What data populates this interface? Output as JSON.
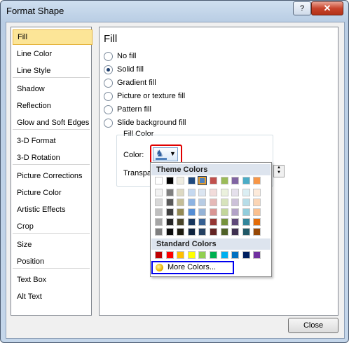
{
  "window": {
    "title": "Format Shape",
    "help_label": "?",
    "close_label": "✕"
  },
  "nav": {
    "items": [
      "Fill",
      "Line Color",
      "Line Style",
      "Shadow",
      "Reflection",
      "Glow and Soft Edges",
      "3-D Format",
      "3-D Rotation",
      "Picture Corrections",
      "Picture Color",
      "Artistic Effects",
      "Crop",
      "Size",
      "Position",
      "Text Box",
      "Alt Text"
    ],
    "selected": "Fill"
  },
  "pane": {
    "title": "Fill",
    "options": [
      "No fill",
      "Solid fill",
      "Gradient fill",
      "Picture or texture fill",
      "Pattern fill",
      "Slide background fill"
    ],
    "selected_option": "Solid fill",
    "group_title": "Fill Color",
    "color_label": "Color:",
    "transparency_label": "Transpa",
    "bucket_icon": "paint-bucket-icon",
    "accent_color": "#4f81bd"
  },
  "palette": {
    "theme_header": "Theme Colors",
    "standard_header": "Standard Colors",
    "more_colors_label": "More Colors...",
    "theme_colors": [
      [
        "#ffffff",
        "#000000",
        "#eeece1",
        "#1f497d",
        "#4f81bd",
        "#c0504d",
        "#9bbb59",
        "#8064a2",
        "#4bacc6",
        "#f79646"
      ],
      [
        "#f2f2f2",
        "#7f7f7f",
        "#ddd9c3",
        "#c6d9f0",
        "#dbe5f1",
        "#f2dcdb",
        "#ebf1dd",
        "#e5e0ec",
        "#dbeef3",
        "#fdeada"
      ],
      [
        "#d8d8d8",
        "#595959",
        "#c4bd97",
        "#8db3e2",
        "#b8cce4",
        "#e5b9b7",
        "#d7e3bc",
        "#ccc1d9",
        "#b7dde8",
        "#fbd5b5"
      ],
      [
        "#bfbfbf",
        "#3f3f3f",
        "#938953",
        "#548dd4",
        "#95b3d7",
        "#d99694",
        "#c3d69b",
        "#b2a2c7",
        "#92cddc",
        "#fac08f"
      ],
      [
        "#a5a5a5",
        "#262626",
        "#494429",
        "#17365d",
        "#366092",
        "#953734",
        "#76923c",
        "#5f497a",
        "#31859b",
        "#e36c09"
      ],
      [
        "#7f7f7f",
        "#0c0c0c",
        "#1d1b10",
        "#0f243e",
        "#244061",
        "#632423",
        "#4f6128",
        "#3f3151",
        "#205867",
        "#974806"
      ]
    ],
    "standard_colors": [
      "#c00000",
      "#ff0000",
      "#ffc000",
      "#ffff00",
      "#92d050",
      "#00b050",
      "#00b0f0",
      "#0070c0",
      "#002060",
      "#7030a0"
    ],
    "selected_theme_color": "#4f81bd"
  },
  "footer": {
    "close_label": "Close"
  }
}
